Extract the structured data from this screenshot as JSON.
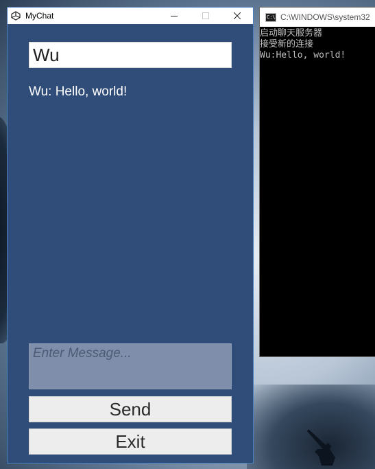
{
  "mychat": {
    "title": "MyChat",
    "name_value": "Wu",
    "chat_lines": [
      "Wu: Hello, world!"
    ],
    "message_placeholder": "Enter Message...",
    "send_label": "Send",
    "exit_label": "Exit",
    "icons": {
      "app": "unity-logo-icon",
      "minimize": "minimize-icon",
      "maximize": "maximize-icon",
      "close": "close-icon"
    }
  },
  "console": {
    "title": "C:\\WINDOWS\\system32",
    "lines": [
      "启动聊天服务器",
      "接受新的连接",
      "Wu:Hello, world!"
    ],
    "icon": "console-icon"
  },
  "colors": {
    "window_bg": "#2f4d78",
    "input_bg": "#ffffff",
    "message_bg": "#7f8eab",
    "button_bg": "#ededed",
    "console_bg": "#000000"
  }
}
